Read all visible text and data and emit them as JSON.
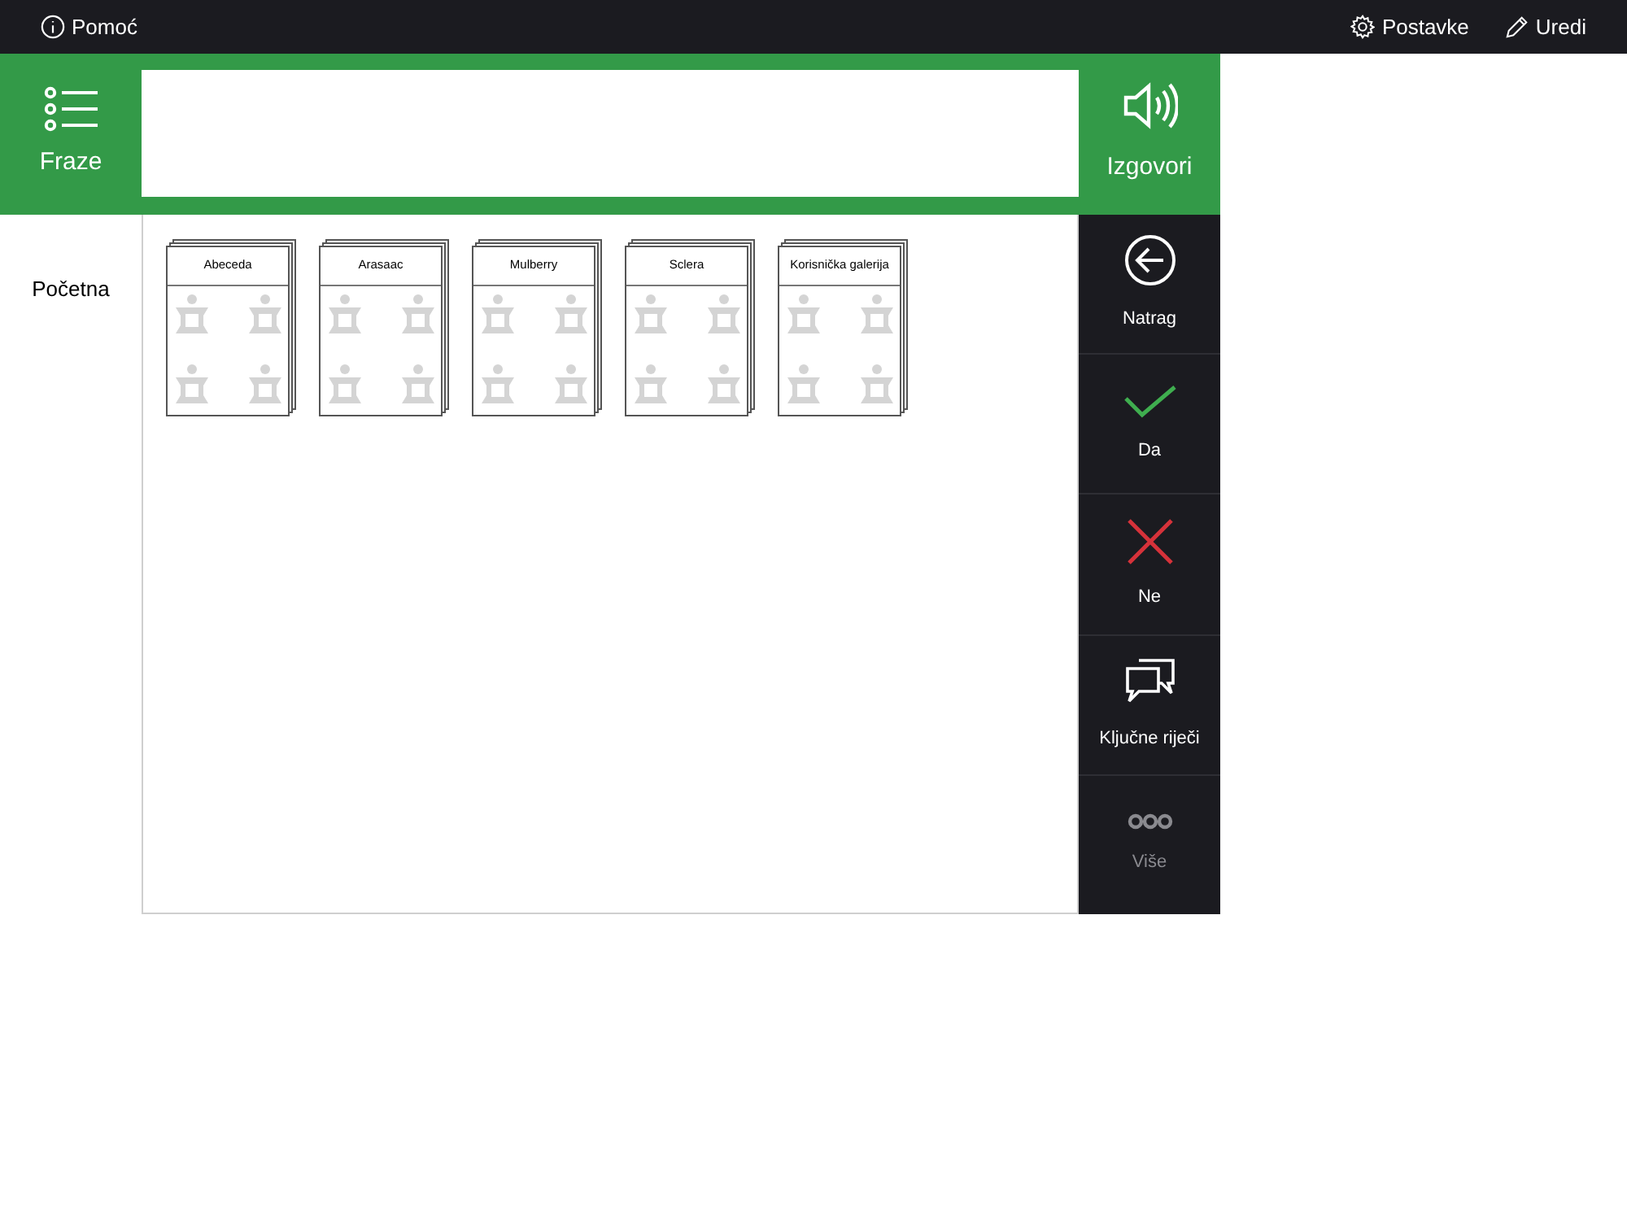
{
  "top_bar": {
    "help": "Pomoć",
    "settings": "Postavke",
    "edit": "Uredi"
  },
  "phrases_button": {
    "label": "Fraze"
  },
  "speak_button": {
    "label": "Izgovori"
  },
  "sidebar": {
    "items": [
      {
        "label": "Početna",
        "selected": true
      }
    ]
  },
  "galleries": [
    {
      "title": "Abeceda"
    },
    {
      "title": "Arasaac"
    },
    {
      "title": "Mulberry"
    },
    {
      "title": "Sclera"
    },
    {
      "title": "Korisnička galerija"
    }
  ],
  "actions": [
    {
      "kind": "back",
      "label": "Natrag",
      "disabled": false
    },
    {
      "kind": "yes",
      "label": "Da",
      "disabled": false
    },
    {
      "kind": "no",
      "label": "Ne",
      "disabled": false
    },
    {
      "kind": "keywords",
      "label": "Ključne riječi",
      "disabled": false
    },
    {
      "kind": "more",
      "label": "Više",
      "disabled": true
    }
  ]
}
